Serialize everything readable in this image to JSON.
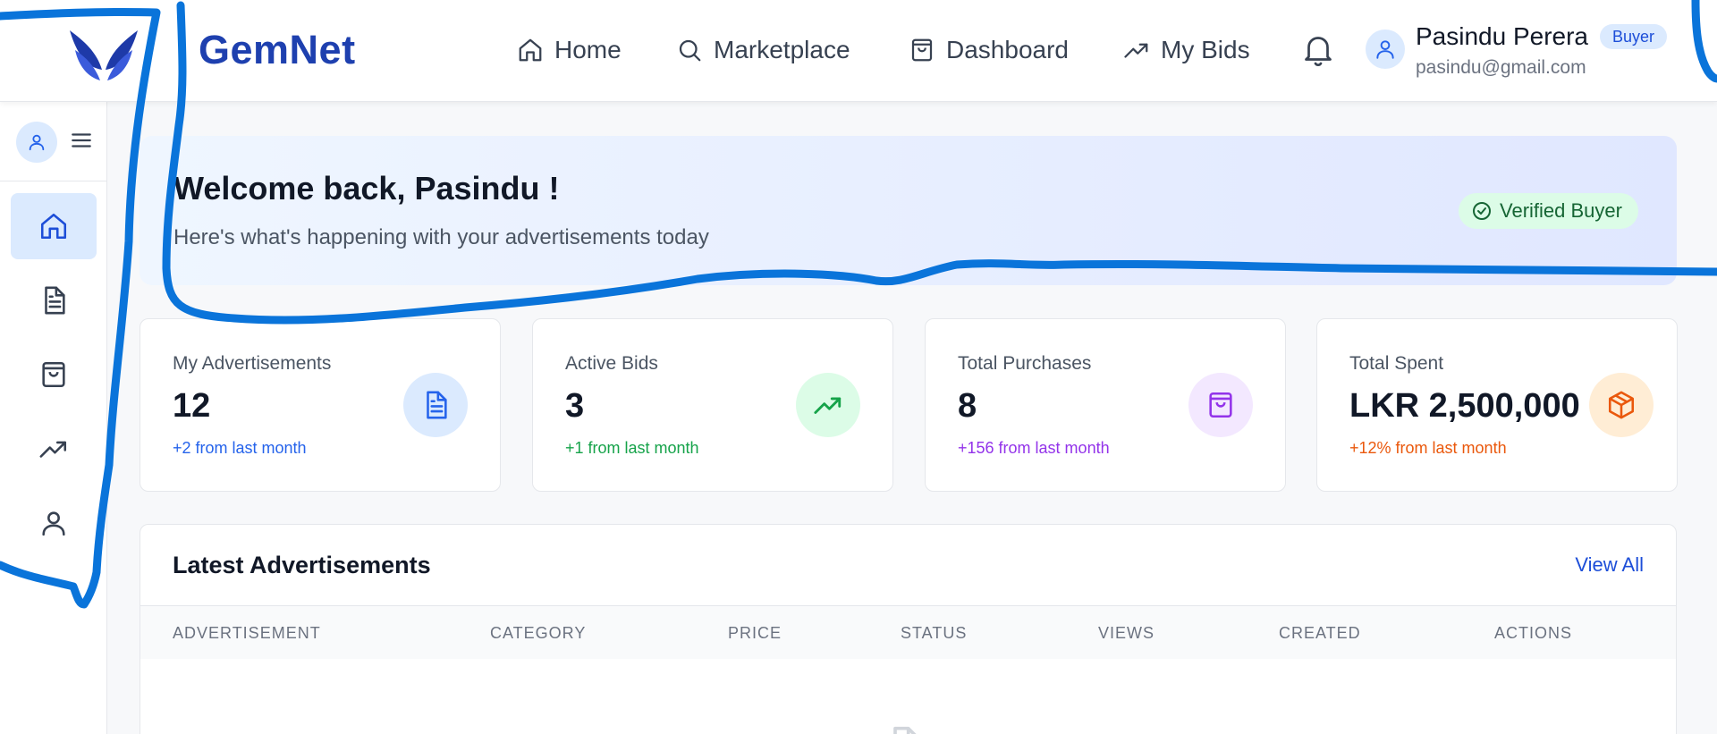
{
  "brand": {
    "name": "GemNet"
  },
  "nav": {
    "home": "Home",
    "marketplace": "Marketplace",
    "dashboard": "Dashboard",
    "my_bids": "My Bids"
  },
  "user": {
    "name": "Pasindu Perera",
    "role": "Buyer",
    "email": "pasindu@gmail.com"
  },
  "sidebar": {
    "items": [
      {
        "icon": "home-icon",
        "active": true
      },
      {
        "icon": "document-icon",
        "active": false
      },
      {
        "icon": "shopping-bag-icon",
        "active": false
      },
      {
        "icon": "trending-up-icon",
        "active": false
      },
      {
        "icon": "user-icon",
        "active": false
      }
    ]
  },
  "welcome": {
    "title": "Welcome back, Pasindu !",
    "subtitle": "Here's what's happening with your advertisements today",
    "badge": "Verified Buyer"
  },
  "stats": [
    {
      "label": "My Advertisements",
      "value": "12",
      "delta": "+2 from last month",
      "color": "#2563eb",
      "icon_bg": "#dbeafe",
      "icon": "document-icon"
    },
    {
      "label": "Active Bids",
      "value": "3",
      "delta": "+1 from last month",
      "color": "#16a34a",
      "icon_bg": "#dcfce7",
      "icon": "trending-up-icon"
    },
    {
      "label": "Total Purchases",
      "value": "8",
      "delta": "+156 from last month",
      "color": "#9333ea",
      "icon_bg": "#f3e8ff",
      "icon": "shopping-bag-icon"
    },
    {
      "label": "Total Spent",
      "value": "LKR 2,500,000",
      "delta": "+12% from last month",
      "color": "#ea580c",
      "icon_bg": "#ffedd5",
      "icon": "box-icon"
    }
  ],
  "latest": {
    "title": "Latest Advertisements",
    "view_all": "View All",
    "columns": [
      "ADVERTISEMENT",
      "CATEGORY",
      "PRICE",
      "STATUS",
      "VIEWS",
      "CREATED",
      "ACTIONS"
    ]
  },
  "colors": {
    "brand": "#1e40af",
    "accent": "#2563eb",
    "annotation": "#0a74da"
  }
}
